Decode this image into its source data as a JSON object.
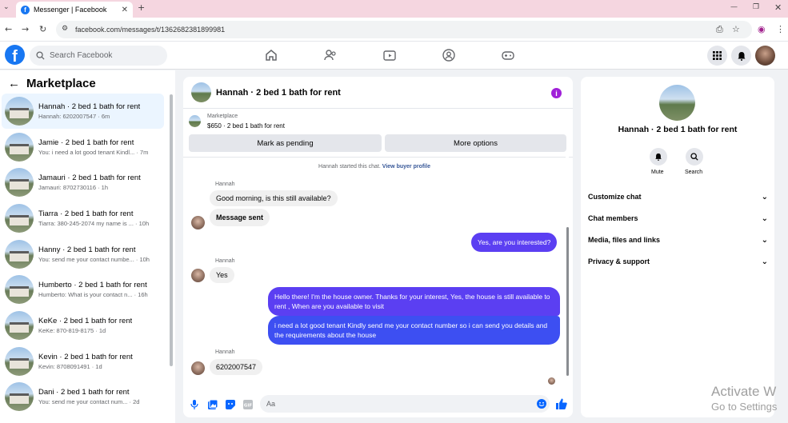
{
  "browser": {
    "tab_title": "Messenger | Facebook",
    "new_tab": "+",
    "url": "facebook.com/messages/t/1362682381899981"
  },
  "header": {
    "logo": "f",
    "search_placeholder": "Search Facebook",
    "nav_icons": [
      "home-icon",
      "friends-icon",
      "watch-icon",
      "groups-icon",
      "gaming-icon"
    ],
    "right_icons": [
      "menu-grid-icon",
      "notifications-icon",
      "profile-avatar"
    ]
  },
  "sidebar": {
    "title": "Marketplace",
    "conversations": [
      {
        "name": "Hannah · 2 bed 1 bath for rent",
        "preview": "Hannah: 6202007547 · 6m",
        "time": "",
        "active": true
      },
      {
        "name": "Jamie · 2 bed 1 bath for rent",
        "preview": "You: i need a lot good tenant Kindl...",
        "time": "7m"
      },
      {
        "name": "Jamauri · 2 bed 1 bath for rent",
        "preview": "Jamauri: 8702730116 · 1h",
        "time": ""
      },
      {
        "name": "Tiarra · 2 bed 1 bath for rent",
        "preview": "Tiarra: 380-245-2074 my name is ...",
        "time": "10h"
      },
      {
        "name": "Hanny · 2 bed 1 bath for rent",
        "preview": "You: send me your contact numbe...",
        "time": "10h"
      },
      {
        "name": "Humberto · 2 bed 1 bath for rent",
        "preview": "Humberto: What is your contact n...",
        "time": "16h"
      },
      {
        "name": "KeKe · 2 bed 1 bath for rent",
        "preview": "KeKe: 870-819-8175 · 1d",
        "time": ""
      },
      {
        "name": "Kevin · 2 bed 1 bath for rent",
        "preview": "Kevin: 8708091491 · 1d",
        "time": ""
      },
      {
        "name": "Dani · 2 bed 1 bath for rent",
        "preview": "You: send me your contact num...",
        "time": "2d"
      }
    ]
  },
  "chat": {
    "title": "Hannah · 2 bed 1 bath for rent",
    "listing_source": "Marketplace",
    "listing_text": "$650 · 2 bed 1 bath for rent",
    "mark_pending": "Mark as pending",
    "more_options": "More options",
    "system_note": "Hannah started this chat.",
    "system_link": "View buyer profile",
    "messages": {
      "s1": "Hannah",
      "m1": "Good morning, is this still available?",
      "m2": "Message sent",
      "o1": "Yes, are you interested?",
      "s2": "Hannah",
      "m3": "Yes",
      "o2": "Hello there! I'm the house owner. Thanks for your interest, Yes, the house is still available to rent , When are you available to visit",
      "o3": "i need a lot good tenant Kindly send me your contact number so i can send you details and the requirements about the house",
      "s3": "Hannah",
      "m4": "6202007547"
    },
    "input_placeholder": "Aa"
  },
  "info": {
    "name": "Hannah · 2 bed 1 bath for rent",
    "mute": "Mute",
    "search": "Search",
    "rows": [
      "Customize chat",
      "Chat members",
      "Media, files and links",
      "Privacy & support"
    ]
  },
  "watermark": {
    "line1": "Activate W",
    "line2": "Go to Settings"
  },
  "colors": {
    "brand": "#1877f2",
    "outgoing": "#5b3ff2",
    "accent_info": "#a020d8"
  }
}
